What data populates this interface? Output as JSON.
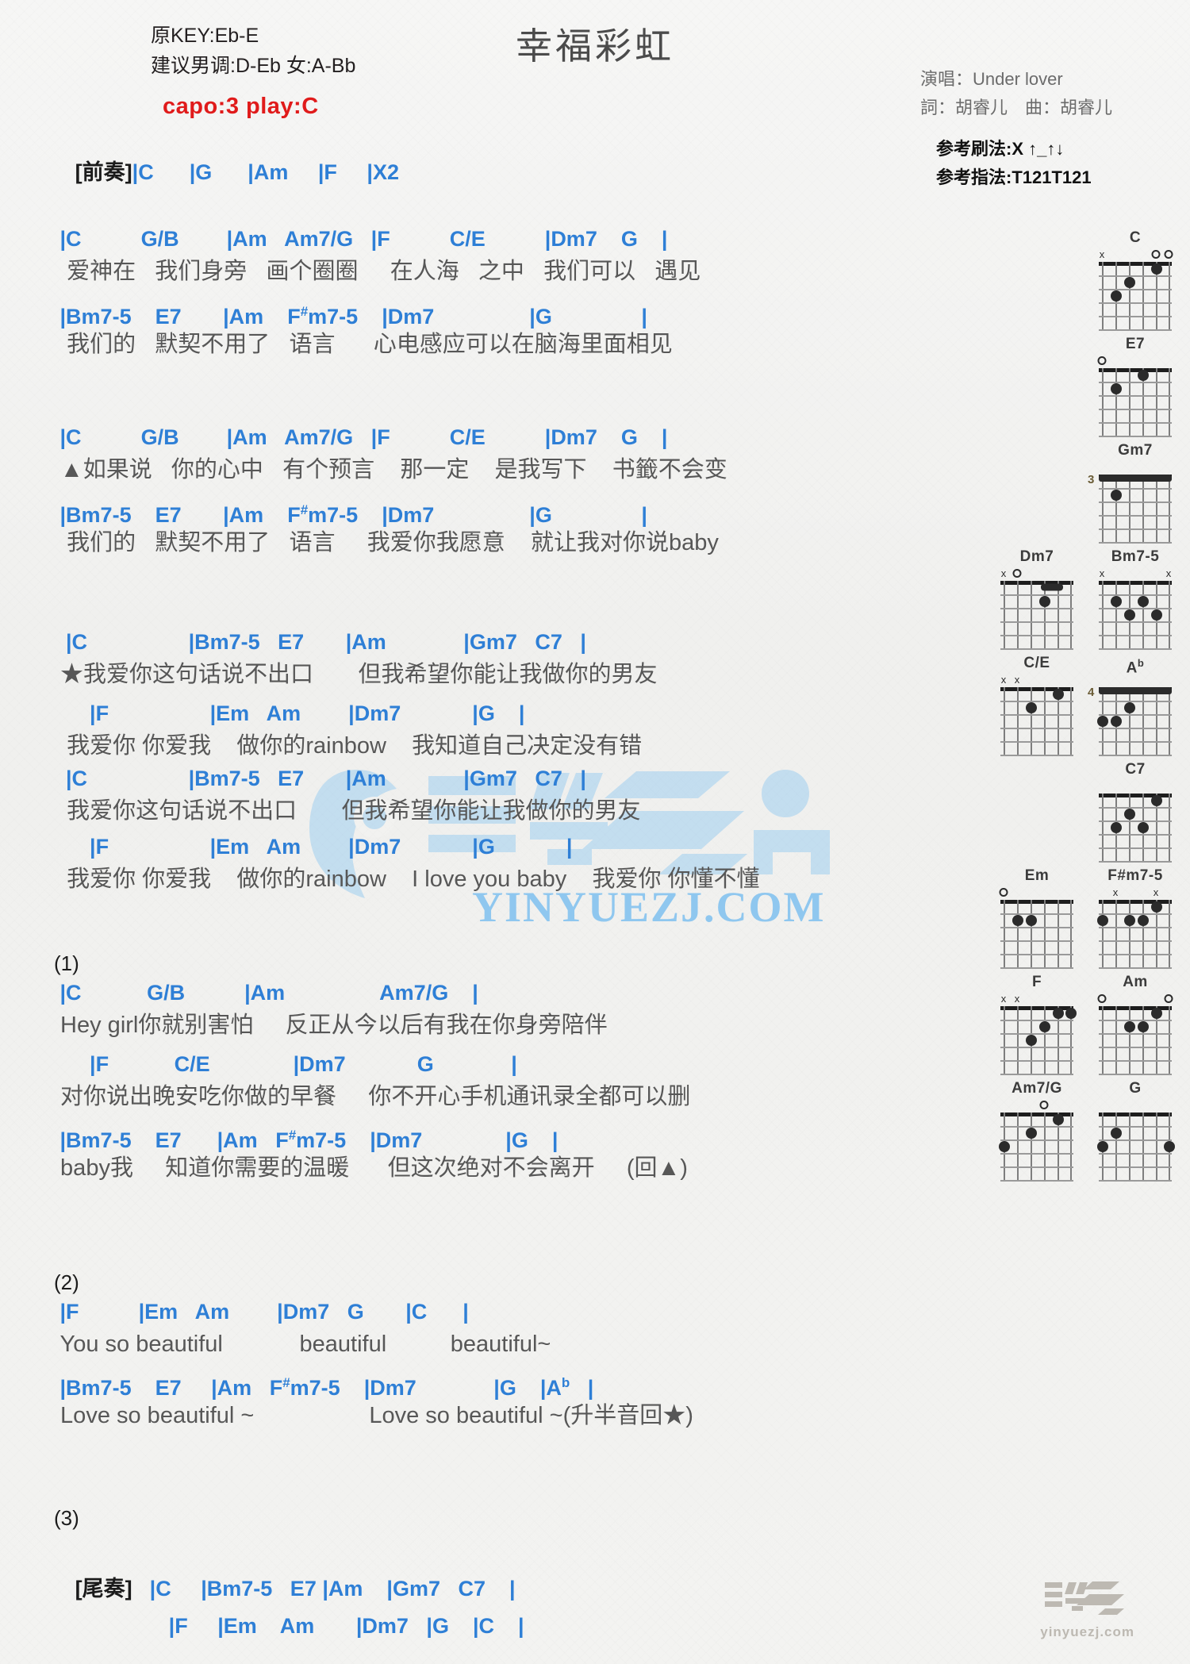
{
  "header": {
    "orig_key": "原KEY:Eb-E",
    "suggest_key": "建议男调:D-Eb 女:A-Bb",
    "capo": "capo:3 play:C",
    "title": "幸福彩虹",
    "singer": "演唱：Under lover",
    "credits": "詞：胡睿儿　曲：胡睿儿",
    "strum": "参考刷法:X ↑_↑↓",
    "fingerstyle": "参考指法:T121T121",
    "capo_color": "#e01b1b",
    "chord_color": "#2e7fd6"
  },
  "intro": {
    "label": "[前奏]",
    "chords": "|C      |G      |Am     |F     |X2"
  },
  "sections": [
    {
      "name": "verse-1",
      "lines": [
        {
          "type": "chord",
          "text": " |C          G/B        |Am   Am7/G   |F          C/E          |Dm7    G    |"
        },
        {
          "type": "lyric",
          "text": "  爱神在   我们身旁   画个圈圈     在人海   之中   我们可以   遇见"
        },
        {
          "type": "chord",
          "text": " |Bm7-5    E7       |Am    F#m7-5    |Dm7                |G               |"
        },
        {
          "type": "lyric",
          "text": "  我们的   默契不用了   语言      心电感应可以在脑海里面相见"
        }
      ]
    },
    {
      "name": "verse-2",
      "lines": [
        {
          "type": "chord",
          "text": " |C          G/B        |Am   Am7/G   |F          C/E          |Dm7    G    |"
        },
        {
          "type": "lyric",
          "text": " ▲如果说   你的心中   有个预言    那一定    是我写下    书籤不会变"
        },
        {
          "type": "chord",
          "text": " |Bm7-5    E7       |Am    F#m7-5    |Dm7                |G               |"
        },
        {
          "type": "lyric",
          "text": "  我们的   默契不用了   语言     我爱你我愿意    就让我对你说baby"
        }
      ]
    },
    {
      "name": "chorus-1",
      "lines": [
        {
          "type": "chord",
          "text": "  |C                 |Bm7-5   E7       |Am             |Gm7   C7   |"
        },
        {
          "type": "lyric",
          "text": " ★我爱你这句话说不出口       但我希望你能让我做你的男友"
        },
        {
          "type": "chord",
          "text": "      |F                 |Em   Am        |Dm7            |G    |"
        },
        {
          "type": "lyric",
          "text": "  我爱你 你爱我    做你的rainbow    我知道自己决定没有错"
        },
        {
          "type": "chord",
          "text": "  |C                 |Bm7-5   E7       |Am             |Gm7   C7   |"
        },
        {
          "type": "lyric",
          "text": "  我爱你这句话说不出口       但我希望你能让我做你的男友"
        },
        {
          "type": "chord",
          "text": "      |F                 |Em   Am        |Dm7            |G            |"
        },
        {
          "type": "lyric",
          "text": "  我爱你 你爱我    做你的rainbow    I love you baby    我爱你 你懂不懂"
        }
      ]
    },
    {
      "name": "section-1",
      "marker": "(1)",
      "lines": [
        {
          "type": "chord",
          "text": " |C           G/B          |Am                Am7/G    |"
        },
        {
          "type": "lyric",
          "text": " Hey girl你就别害怕     反正从今以后有我在你身旁陪伴"
        },
        {
          "type": "chord",
          "text": "      |F           C/E              |Dm7            G             |"
        },
        {
          "type": "lyric",
          "text": " 对你说出晚安吃你做的早餐     你不开心手机通讯录全都可以删"
        },
        {
          "type": "chord",
          "text": " |Bm7-5    E7      |Am   F#m7-5    |Dm7              |G    |"
        },
        {
          "type": "lyric",
          "text": " baby我     知道你需要的温暖      但这次绝对不会离开     (回▲)"
        }
      ]
    },
    {
      "name": "section-2",
      "marker": "(2)",
      "lines": [
        {
          "type": "chord",
          "text": " |F          |Em   Am        |Dm7   G       |C      |"
        },
        {
          "type": "lyric",
          "text": " You so beautiful            beautiful          beautiful~"
        },
        {
          "type": "chord",
          "text": " |Bm7-5    E7     |Am   F#m7-5    |Dm7             |G    |Ab   |"
        },
        {
          "type": "lyric",
          "text": " Love so beautiful ~                  Love so beautiful ~(升半音回★)"
        }
      ]
    },
    {
      "name": "section-3",
      "marker": "(3)",
      "lines": []
    }
  ],
  "outro": {
    "label": "[尾奏]",
    "line1": "|C     |Bm7-5   E7 |Am    |Gm7   C7    |",
    "line2": "|F     |Em    Am       |Dm7   |G    |C    |"
  },
  "diagrams": [
    {
      "name": "C",
      "col": 2,
      "fret_label": "",
      "top": [
        "x",
        "",
        "",
        "",
        "o",
        "o"
      ],
      "dots": [
        [
          5,
          3
        ],
        [
          4,
          2
        ],
        [
          2,
          1
        ]
      ],
      "barre": null
    },
    {
      "name": "E7",
      "col": 2,
      "fret_label": "",
      "top": [
        "o",
        "",
        "",
        "",
        "",
        ""
      ],
      "dots": [
        [
          5,
          2
        ],
        [
          3,
          1
        ]
      ],
      "barre": null
    },
    {
      "name": "Gm7",
      "col": 2,
      "fret_label": "3",
      "top": [
        "",
        "",
        "",
        "",
        "",
        ""
      ],
      "dots": [
        [
          5,
          2
        ]
      ],
      "barre": "full"
    },
    {
      "name": "Dm7",
      "col": 1,
      "fret_label": "",
      "top": [
        "x",
        "o",
        "",
        "",
        "",
        ""
      ],
      "dots": [
        [
          3,
          2
        ]
      ],
      "barre": "partial"
    },
    {
      "name": "Bm7-5",
      "col": 2,
      "fret_label": "",
      "top": [
        "x",
        "",
        "",
        "",
        "",
        "x"
      ],
      "dots": [
        [
          5,
          2
        ],
        [
          3,
          2
        ],
        [
          4,
          3
        ],
        [
          2,
          3
        ]
      ],
      "barre": null
    },
    {
      "name": "C/E",
      "col": 1,
      "fret_label": "",
      "top": [
        "x",
        "x",
        "",
        "",
        "",
        ""
      ],
      "dots": [
        [
          4,
          2
        ],
        [
          2,
          1
        ]
      ],
      "barre": null
    },
    {
      "name": "Ab",
      "col": 2,
      "fret_label": "4",
      "top": [
        "",
        "",
        "",
        "",
        "",
        ""
      ],
      "dots": [
        [
          4,
          2
        ],
        [
          5,
          3
        ],
        [
          6,
          3
        ]
      ],
      "barre": "full"
    },
    {
      "name": "C7",
      "col": 2,
      "fret_label": "",
      "top": [
        "",
        "",
        "",
        "",
        "",
        ""
      ],
      "dots": [
        [
          2,
          1
        ],
        [
          4,
          2
        ],
        [
          5,
          3
        ],
        [
          3,
          3
        ]
      ],
      "barre": null
    },
    {
      "name": "Em",
      "col": 1,
      "fret_label": "",
      "top": [
        "o",
        "",
        "",
        "",
        "",
        ""
      ],
      "dots": [
        [
          5,
          2
        ],
        [
          4,
          2
        ]
      ],
      "barre": null
    },
    {
      "name": "F#m7-5",
      "col": 2,
      "fret_label": "",
      "top": [
        "",
        "x",
        "",
        "",
        "x",
        ""
      ],
      "dots": [
        [
          6,
          2
        ],
        [
          4,
          2
        ],
        [
          3,
          2
        ],
        [
          2,
          1
        ]
      ],
      "barre": null
    },
    {
      "name": "F",
      "col": 1,
      "fret_label": "",
      "top": [
        "x",
        "x",
        "",
        "",
        "",
        ""
      ],
      "dots": [
        [
          2,
          1
        ],
        [
          1,
          1
        ],
        [
          3,
          2
        ],
        [
          4,
          3
        ]
      ],
      "barre": null
    },
    {
      "name": "Am",
      "col": 2,
      "fret_label": "",
      "top": [
        "o",
        "",
        "",
        "",
        "",
        "o"
      ],
      "dots": [
        [
          2,
          1
        ],
        [
          4,
          2
        ],
        [
          3,
          2
        ]
      ],
      "barre": null
    },
    {
      "name": "Am7/G",
      "col": 1,
      "fret_label": "",
      "top": [
        "",
        "",
        "",
        "o",
        "",
        ""
      ],
      "dots": [
        [
          2,
          1
        ],
        [
          4,
          2
        ],
        [
          6,
          3
        ]
      ],
      "barre": null
    },
    {
      "name": "G",
      "col": 2,
      "fret_label": "",
      "top": [
        "",
        "",
        "",
        "",
        "",
        ""
      ],
      "dots": [
        [
          5,
          2
        ],
        [
          6,
          3
        ],
        [
          1,
          3
        ]
      ],
      "barre": null
    }
  ],
  "watermark": {
    "site": "YINYUEZJ.COM",
    "logo_text": "音乐之家",
    "bottom_text": "yinyuezj.com",
    "color": "#8fc7ef"
  }
}
